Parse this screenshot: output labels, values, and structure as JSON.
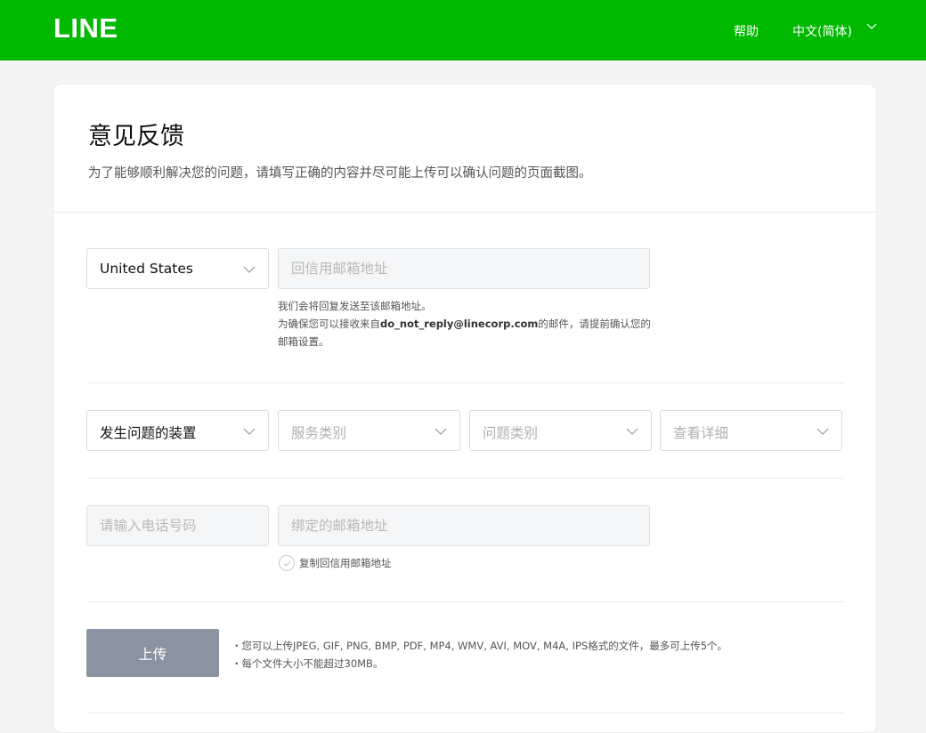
{
  "header": {
    "logo": "LINE",
    "help_label": "帮助",
    "language_label": "中文(简体)",
    "brand_color": "#00b900"
  },
  "page": {
    "title": "意见反馈",
    "subtitle": "为了能够顺利解决您的问题，请填写正确的内容并尽可能上传可以确认问题的页面截图。"
  },
  "form": {
    "country_select": {
      "value": "United States"
    },
    "reply_email": {
      "placeholder": "回信用邮箱地址",
      "value": ""
    },
    "reply_help": {
      "line1": "我们会将回复发送至该邮箱地址。",
      "line2_prefix": "为确保您可以接收来自",
      "line2_email": "do_not_reply@linecorp.com",
      "line2_suffix": "的邮件，请提前确认您的",
      "line3": "邮箱设置。"
    },
    "device_select": {
      "value": "发生问题的装置"
    },
    "service_select": {
      "placeholder": "服务类别"
    },
    "issue_select": {
      "placeholder": "问题类别"
    },
    "detail_select": {
      "placeholder": "查看详细"
    },
    "phone": {
      "placeholder": "请输入电话号码",
      "value": ""
    },
    "linked_email": {
      "placeholder": "绑定的邮箱地址",
      "value": ""
    },
    "copy_reply_email_label": "复制回信用邮箱地址",
    "upload": {
      "button_label": "上传",
      "note_line1": "・您可以上传JPEG, GIF, PNG, BMP, PDF, MP4, WMV, AVI, MOV, M4A, IPS格式的文件，最多可上传5个。",
      "note_line2": "・每个文件大小不能超过30MB。",
      "button_color": "#8a93a0"
    }
  },
  "icons": {
    "dropdown": "chevron-down-icon",
    "checkbox": "check-icon"
  }
}
